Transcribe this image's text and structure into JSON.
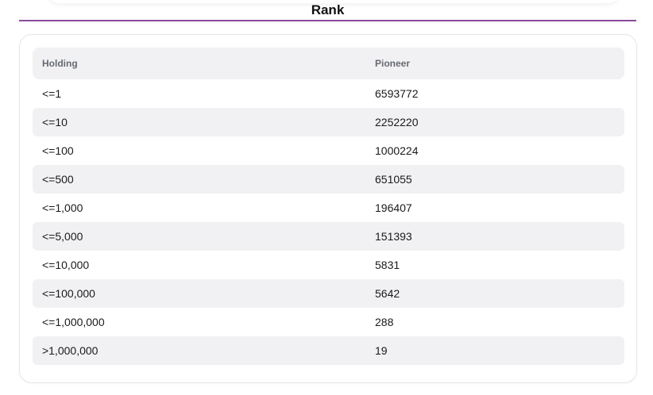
{
  "section": {
    "title": "Rank"
  },
  "table": {
    "headers": {
      "holding": "Holding",
      "pioneer": "Pioneer"
    },
    "rows": [
      {
        "holding": "<=1",
        "pioneer": "6593772"
      },
      {
        "holding": "<=10",
        "pioneer": "2252220"
      },
      {
        "holding": "<=100",
        "pioneer": "1000224"
      },
      {
        "holding": "<=500",
        "pioneer": "651055"
      },
      {
        "holding": "<=1,000",
        "pioneer": "196407"
      },
      {
        "holding": "<=5,000",
        "pioneer": "151393"
      },
      {
        "holding": "<=10,000",
        "pioneer": "5831"
      },
      {
        "holding": "<=100,000",
        "pioneer": "5642"
      },
      {
        "holding": "<=1,000,000",
        "pioneer": "288"
      },
      {
        "holding": ">1,000,000",
        "pioneer": "19"
      }
    ]
  },
  "colors": {
    "accent_underline": "#8a4a9a",
    "row_stripe": "#f1f1f3",
    "header_text": "#666a70"
  }
}
